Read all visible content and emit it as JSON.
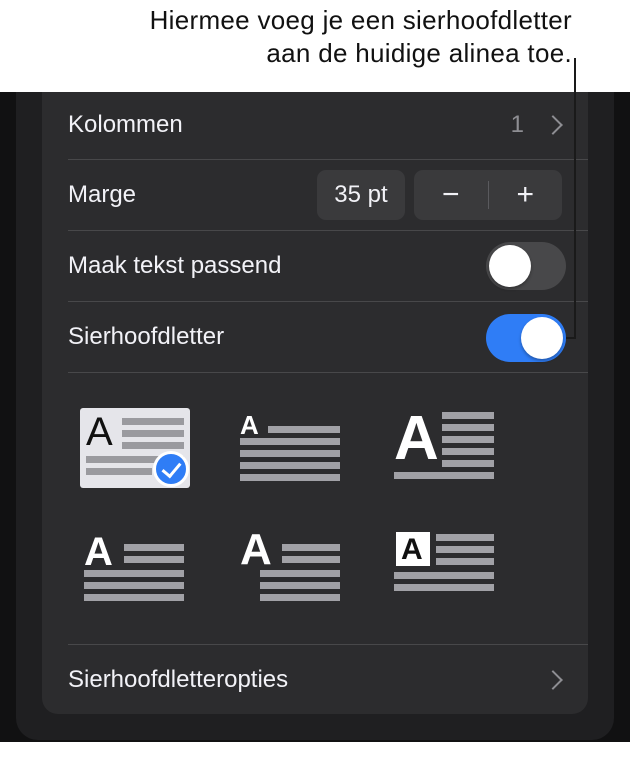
{
  "callout": {
    "line1": "Hiermee voeg je een sierhoofdletter",
    "line2": "aan de huidige alinea toe."
  },
  "rows": {
    "columns": {
      "label": "Kolommen",
      "value": "1"
    },
    "margin": {
      "label": "Marge",
      "value": "35 pt",
      "minus": "−",
      "plus": "+"
    },
    "fit_text": {
      "label": "Maak tekst passend",
      "on": false
    },
    "drop_cap": {
      "label": "Sierhoofdletter",
      "on": true
    },
    "drop_cap_options": {
      "label": "Sierhoofdletteropties"
    }
  },
  "drop_cap_styles": [
    {
      "letter": "A",
      "selected": true
    },
    {
      "letter": "A",
      "selected": false
    },
    {
      "letter": "A",
      "selected": false
    },
    {
      "letter": "A",
      "selected": false
    },
    {
      "letter": "A",
      "selected": false
    },
    {
      "letter": "A",
      "selected": false
    }
  ],
  "colors": {
    "accent": "#2f7df6",
    "panel": "#2c2c2e",
    "text": "#f2f2f7",
    "secondary": "#8e8e93"
  }
}
